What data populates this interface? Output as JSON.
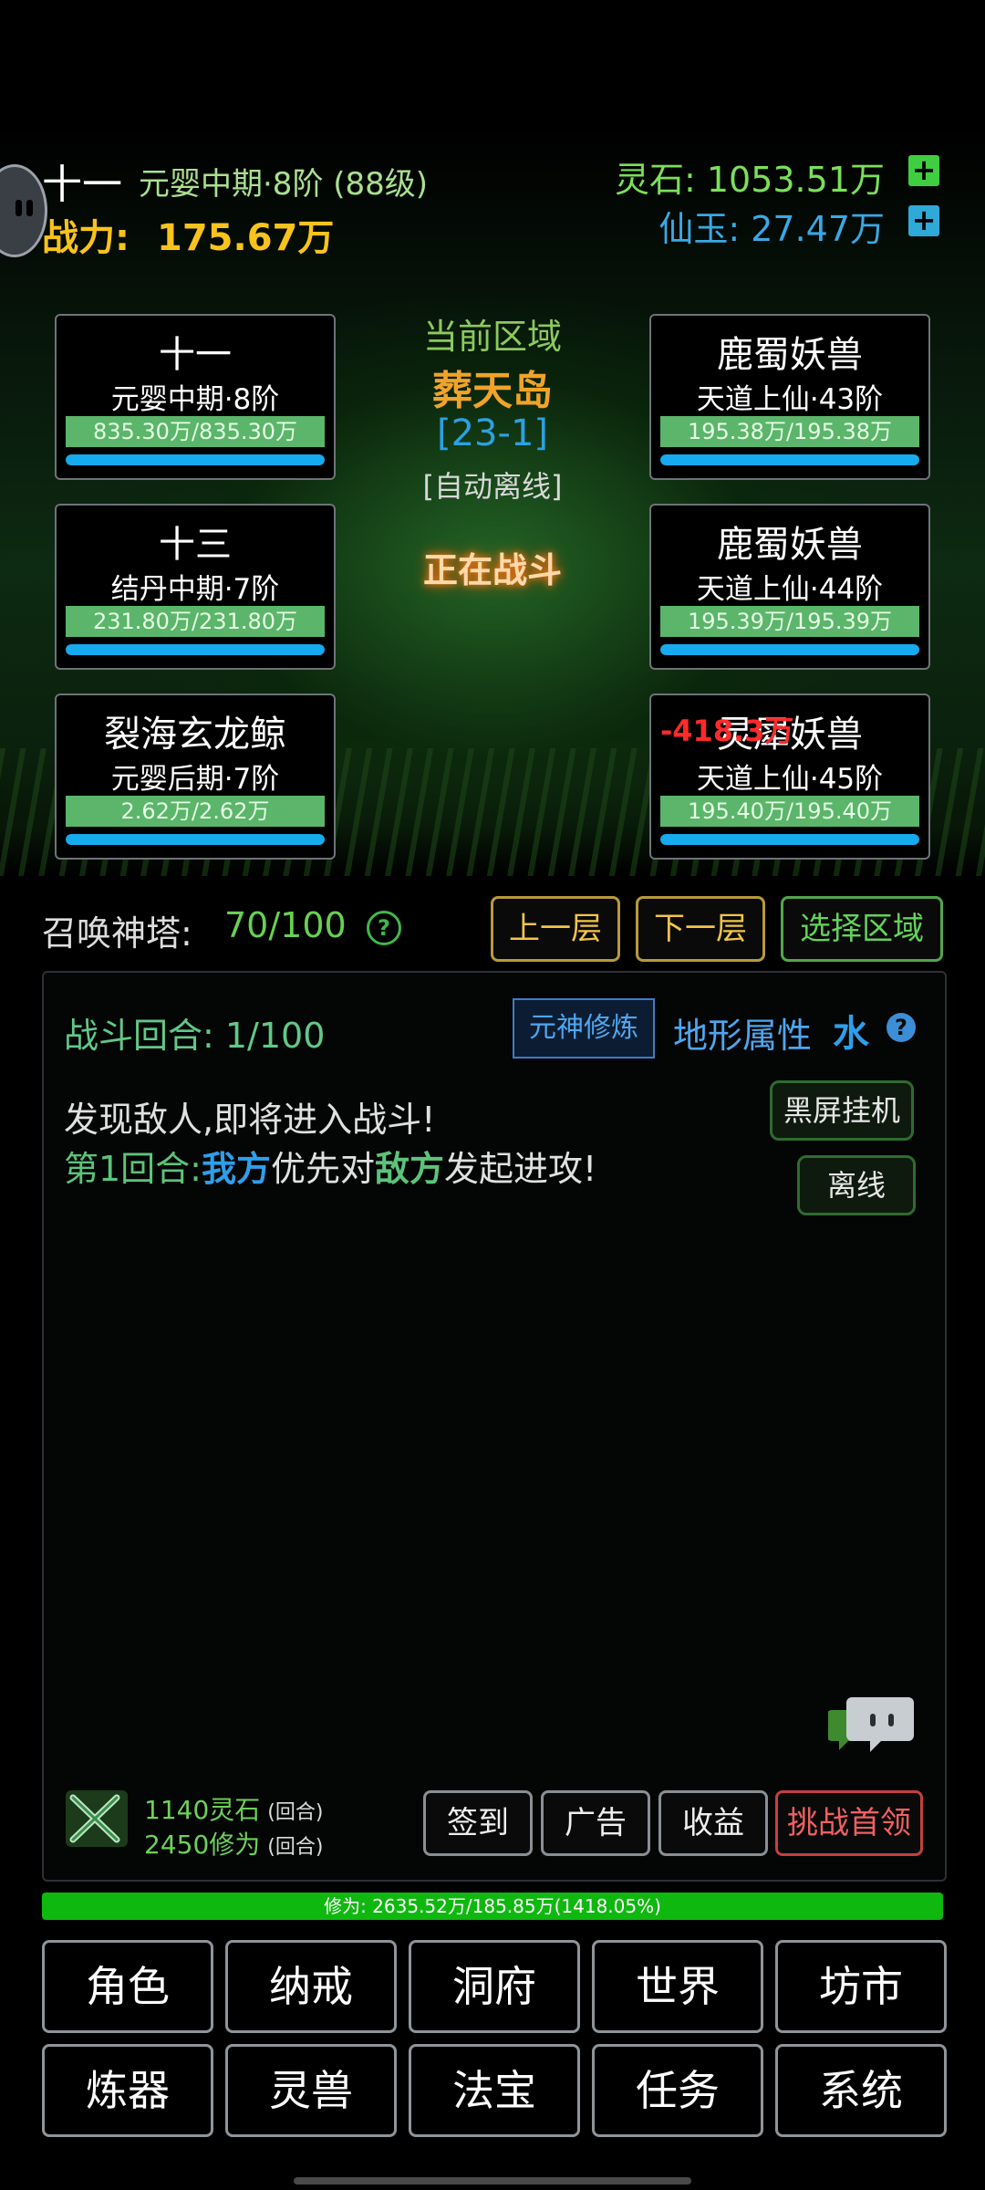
{
  "player": {
    "name": "十一",
    "realm": "元婴中期·8阶 (88级)",
    "power_label": "战力:",
    "power_value": "175.67万"
  },
  "resources": {
    "lingshi": "灵石: 1053.51万",
    "xianyu": "仙玉: 27.47万",
    "plus": "+"
  },
  "zone": {
    "title": "当前区域",
    "name": "葬天岛",
    "stage": "[23-1]",
    "mode": "[自动离线]",
    "status": "正在战斗"
  },
  "allies": [
    {
      "name": "十一",
      "rank": "元婴中期·8阶",
      "hp": "835.30万/835.30万",
      "hp_frac": 1.0
    },
    {
      "name": "十三",
      "rank": "结丹中期·7阶",
      "hp": "231.80万/231.80万",
      "hp_frac": 1.0
    },
    {
      "name": "裂海玄龙鲸",
      "rank": "元婴后期·7阶",
      "hp": "2.62万/2.62万",
      "hp_frac": 1.0
    }
  ],
  "enemies": [
    {
      "name": "鹿蜀妖兽",
      "rank": "天道上仙·43阶",
      "hp": "195.38万/195.38万",
      "hp_frac": 1.0
    },
    {
      "name": "鹿蜀妖兽",
      "rank": "天道上仙·44阶",
      "hp": "195.39万/195.39万",
      "hp_frac": 1.0
    },
    {
      "name": "灵犀妖兽",
      "rank": "天道上仙·45阶",
      "hp": "195.40万/195.40万",
      "hp_frac": 1.0,
      "damage": "-418.3万"
    }
  ],
  "tower": {
    "label": "召唤神塔:",
    "value": "70/100",
    "help": "?",
    "prev": "上一层",
    "next": "下一层",
    "select": "选择区域"
  },
  "battle": {
    "round_label": "战斗回合: 1/100",
    "yuanshen": "元神修炼",
    "terrain_label": "地形属性",
    "terrain_value": "水",
    "terrain_help": "?",
    "log_line1": "发现敌人,即将进入战斗!",
    "log_line2_prefix": "第1回合:",
    "log_line2_us": "我方",
    "log_line2_mid": "优先对",
    "log_line2_enemy": "敌方",
    "log_line2_suffix": "发起进攻!",
    "black_screen": "黑屏挂机",
    "offline": "离线"
  },
  "rewards": {
    "lingshi": "1140灵石",
    "xiuwei": "2450修为",
    "per_round": "(回合)"
  },
  "actions": {
    "signin": "签到",
    "ad": "广告",
    "income": "收益",
    "challenge": "挑战首领"
  },
  "xiuwei_bar": {
    "text": "修为: 2635.52万/185.85万(1418.05%)",
    "fill": 1.0
  },
  "menu": {
    "row1": [
      "角色",
      "纳戒",
      "洞府",
      "世界",
      "坊市"
    ],
    "row2": [
      "炼器",
      "灵兽",
      "法宝",
      "任务",
      "系统"
    ]
  },
  "colors": {
    "green_accent": "#67d150",
    "blue_accent": "#2e9fea",
    "gold": "#f7c31c",
    "hp_green": "#5bb56a",
    "mana_blue": "#16aaee",
    "damage_red": "#ff2a2a"
  }
}
